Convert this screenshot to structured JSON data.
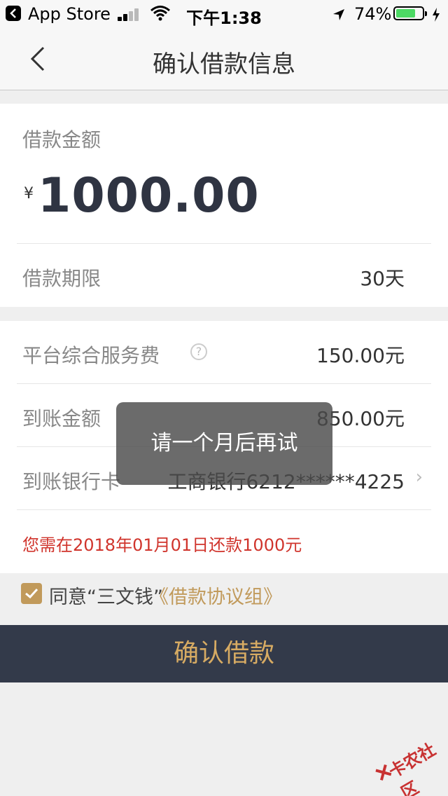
{
  "status_bar": {
    "back_app": "App Store",
    "time": "下午1:38",
    "battery_percent": "74%",
    "battery_level": 0.74,
    "icons": [
      "back-app-icon",
      "signal-icon",
      "wifi-icon",
      "location-arrow-icon",
      "battery-icon",
      "charging-bolt-icon"
    ]
  },
  "nav": {
    "title": "确认借款信息",
    "back_icon": "chevron-left-icon"
  },
  "loan": {
    "amount_label": "借款金额",
    "currency": "¥",
    "amount": "1000.00",
    "term_label": "借款期限",
    "term_value": "30天"
  },
  "fees": {
    "service_fee_label": "平台综合服务费",
    "service_fee_value": "150.00元",
    "help_icon": "question-circle-icon",
    "received_label": "到账金额",
    "received_value": "850.00元",
    "bank_label": "到账银行卡",
    "bank_value": "工商银行6212******4225",
    "notice": "您需在2018年01月01日还款1000元"
  },
  "agreement": {
    "prefix": "同意“三文钱”",
    "link": "《借款协议组》",
    "checked": true
  },
  "confirm_button": "确认借款",
  "toast": "请一个月后再试",
  "watermark": "卡农社区",
  "colors": {
    "accent_gold": "#c19a5b",
    "button_bg": "#333a4a",
    "notice_red": "#d0342c",
    "battery_green": "#4cd964"
  }
}
